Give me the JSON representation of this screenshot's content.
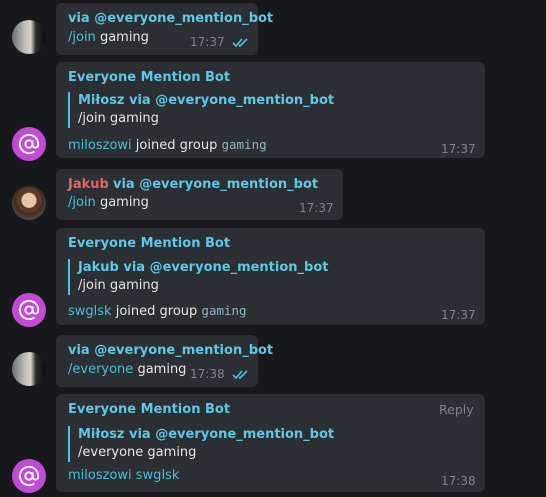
{
  "messages": [
    {
      "id": "m1",
      "header": "via @everyone_mention_bot",
      "command": "/join",
      "text": "gaming",
      "time": "17:37",
      "read": "double-check"
    },
    {
      "id": "m2",
      "bot_name": "Everyone Mention Bot",
      "quote_header": "Miłosz via @everyone_mention_bot",
      "quote_text": "/join gaming",
      "user_link": "miloszowi",
      "body": "joined group",
      "group": "gaming",
      "time": "17:37"
    },
    {
      "id": "m3",
      "sender": "Jakub",
      "via": "via @everyone_mention_bot",
      "command": "/join",
      "text": "gaming",
      "time": "17:37"
    },
    {
      "id": "m4",
      "bot_name": "Everyone Mention Bot",
      "quote_header": "Jakub via @everyone_mention_bot",
      "quote_text": "/join gaming",
      "user_link": "swglsk",
      "body": "joined group",
      "group": "gaming",
      "time": "17:37"
    },
    {
      "id": "m5",
      "header": "via @everyone_mention_bot",
      "command": "/everyone",
      "text": "gaming",
      "time": "17:38",
      "read": "double-check"
    },
    {
      "id": "m6",
      "bot_name": "Everyone Mention Bot",
      "reply_label": "Reply",
      "quote_header": "Miłosz via @everyone_mention_bot",
      "quote_text": "/everyone gaming",
      "mentions": [
        "miloszowi",
        "swglsk"
      ],
      "time": "17:38"
    }
  ],
  "colors": {
    "background": "#17181b",
    "bubble": "#2b2f33",
    "accent": "#5ec8e6",
    "sender_jakub": "#e06767",
    "bot_avatar": "#c24bd6"
  }
}
